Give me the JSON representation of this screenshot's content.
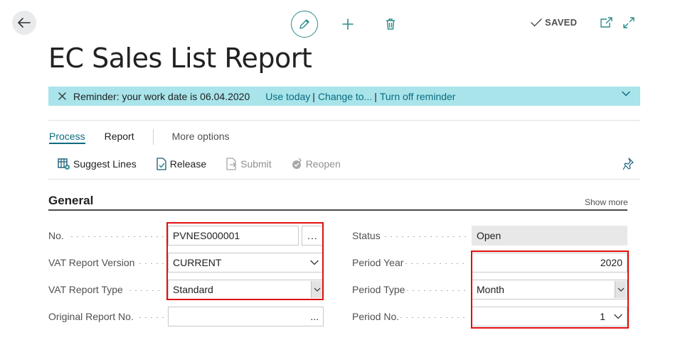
{
  "header": {
    "saved_label": "SAVED",
    "icons": [
      "back-arrow-icon",
      "edit-pencil-icon",
      "plus-icon",
      "trash-icon",
      "checkmark-icon",
      "open-new-window-icon",
      "expand-icon"
    ]
  },
  "page": {
    "title": "EC Sales List Report"
  },
  "reminder": {
    "text": "Reminder: your work date is 06.04.2020",
    "links": [
      "Use today",
      "Change to...",
      "Turn off reminder"
    ],
    "separator": "|"
  },
  "action_tabs": [
    "Process",
    "Report",
    "More options"
  ],
  "actions": [
    {
      "label": "Suggest Lines",
      "icon": "suggest-lines-icon",
      "enabled": true
    },
    {
      "label": "Release",
      "icon": "release-doc-icon",
      "enabled": true
    },
    {
      "label": "Submit",
      "icon": "submit-icon",
      "enabled": false
    },
    {
      "label": "Reopen",
      "icon": "reopen-icon",
      "enabled": false
    }
  ],
  "general": {
    "title": "General",
    "show_more": "Show more",
    "fields_left": [
      {
        "label": "No.",
        "value": "PVNES000001",
        "lookup": "..."
      },
      {
        "label": "VAT Report Version",
        "value": "CURRENT"
      },
      {
        "label": "VAT Report Type",
        "value": "Standard"
      },
      {
        "label": "Original Report No.",
        "value": "",
        "lookup": "..."
      }
    ],
    "fields_right": [
      {
        "label": "Status",
        "value": "Open"
      },
      {
        "label": "Period Year",
        "value": "2020"
      },
      {
        "label": "Period Type",
        "value": "Month"
      },
      {
        "label": "Period No.",
        "value": "1"
      }
    ]
  },
  "colors": {
    "accent": "#0c6b80",
    "reminder_bg": "#a8e4ea",
    "highlight": "#e01010"
  }
}
